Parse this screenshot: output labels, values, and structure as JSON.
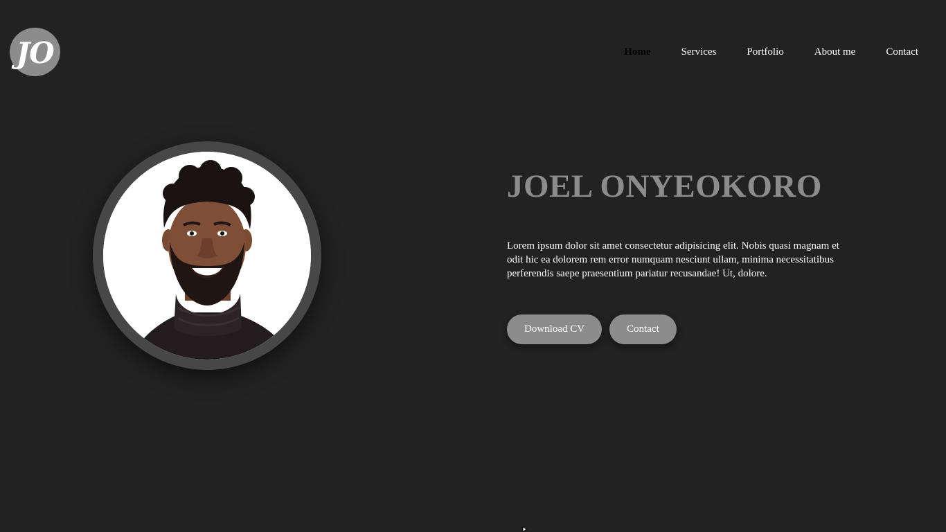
{
  "logo": {
    "text": "JO"
  },
  "nav": {
    "items": [
      {
        "label": "Home",
        "active": true
      },
      {
        "label": "Services",
        "active": false
      },
      {
        "label": "Portfolio",
        "active": false
      },
      {
        "label": "About me",
        "active": false
      },
      {
        "label": "Contact",
        "active": false
      }
    ]
  },
  "hero": {
    "name": "JOEL ONYEOKORO",
    "bio": "Lorem ipsum dolor sit amet consectetur adipisicing elit. Nobis quasi magnam et odit hic ea dolorem rem error numquam nesciunt ullam, minima necessitatibus perferendis saepe praesentium pariatur recusandae! Ut, dolore.",
    "download_label": "Download CV",
    "contact_label": "Contact"
  },
  "colors": {
    "background": "#222222",
    "accent_gray": "#8c8c8c",
    "ring": "#474747",
    "text": "#ffffff",
    "active_nav": "#000000"
  }
}
